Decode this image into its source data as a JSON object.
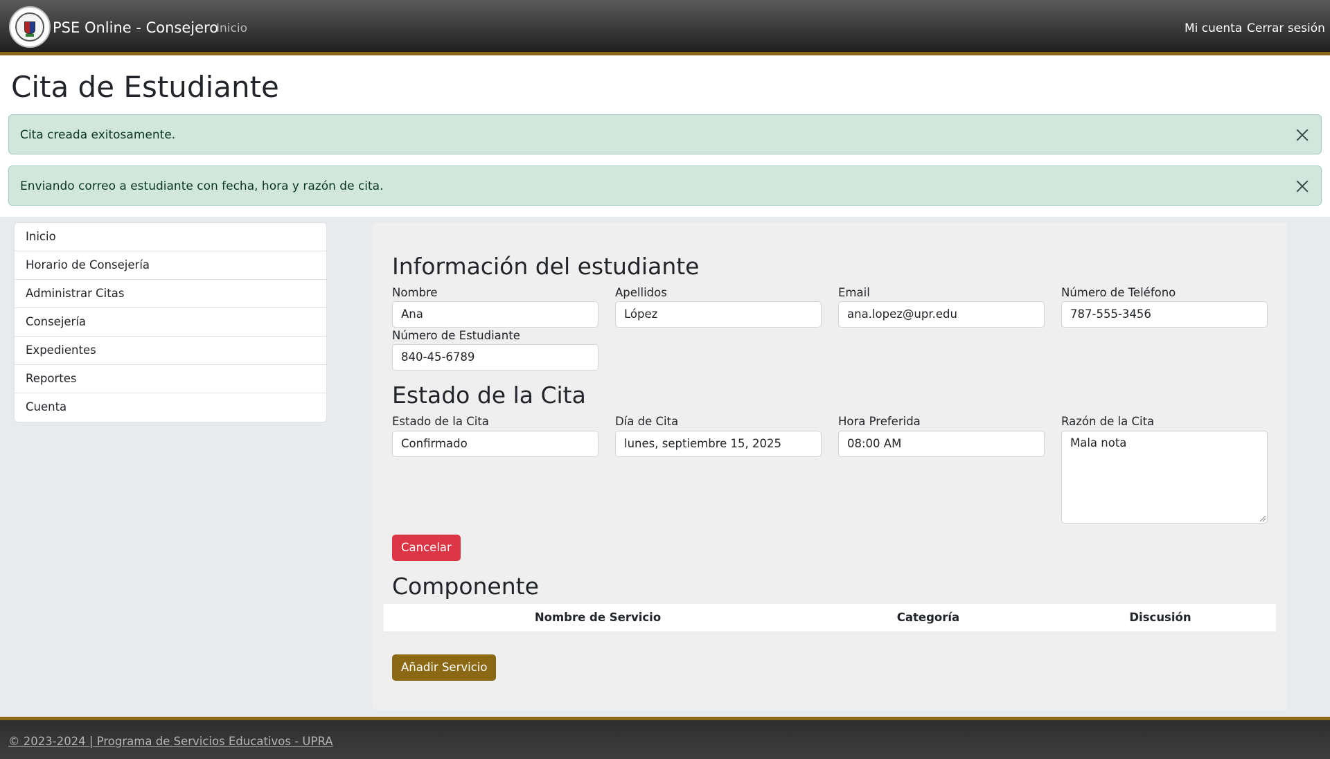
{
  "header": {
    "brand": "PSE Online - Consejero",
    "nav_home": "Inicio",
    "account": "Mi cuenta",
    "logout": "Cerrar sesión"
  },
  "page": {
    "title": "Cita de Estudiante"
  },
  "alerts": [
    {
      "text": "Cita creada exitosamente."
    },
    {
      "text": "Enviando correo a estudiante con fecha, hora y razón de cita."
    }
  ],
  "sidebar": {
    "items": [
      {
        "label": "Inicio"
      },
      {
        "label": "Horario de Consejería"
      },
      {
        "label": "Administrar Citas"
      },
      {
        "label": "Consejería"
      },
      {
        "label": "Expedientes"
      },
      {
        "label": "Reportes"
      },
      {
        "label": "Cuenta"
      }
    ]
  },
  "student_info": {
    "title": "Información del estudiante",
    "nombre_label": "Nombre",
    "nombre": "Ana",
    "apellidos_label": "Apellidos",
    "apellidos": "López",
    "email_label": "Email",
    "email": "ana.lopez@upr.edu",
    "telefono_label": "Número de Teléfono",
    "telefono": "787-555-3456",
    "numero_label": "Número de Estudiante",
    "numero": "840-45-6789"
  },
  "appointment": {
    "title": "Estado de la Cita",
    "estado_label": "Estado de la Cita",
    "estado": "Confirmado",
    "dia_label": "Día de Cita",
    "dia": "lunes, septiembre 15, 2025",
    "hora_label": "Hora Preferida",
    "hora": "08:00 AM",
    "razon_label": "Razón de la Cita",
    "razon": "Mala nota",
    "cancel_label": "Cancelar"
  },
  "component": {
    "title": "Componente",
    "columns": [
      "Nombre de Servicio",
      "Categoría",
      "Discusión"
    ],
    "add_label": "Añadir Servicio"
  },
  "footer": {
    "text": "© 2023-2024 | Programa de Servicios Educativos - UPRA"
  }
}
